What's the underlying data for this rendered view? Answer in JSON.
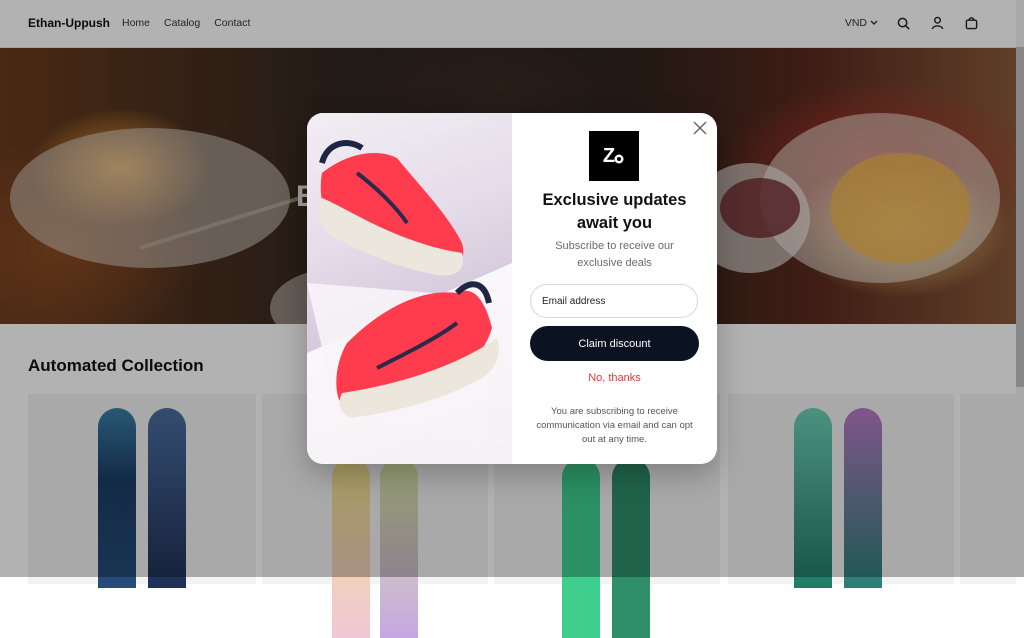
{
  "header": {
    "brand": "Ethan-Uppush",
    "nav": [
      "Home",
      "Catalog",
      "Contact"
    ],
    "currency": "VND",
    "icons": [
      "search-icon",
      "account-icon",
      "cart-icon"
    ]
  },
  "hero": {
    "title": "B"
  },
  "collection": {
    "title": "Automated Collection"
  },
  "popup": {
    "logo_text": "Z",
    "title": "Exclusive updates await you",
    "subtitle": "Subscribe to receive our exclusive deals",
    "email_placeholder": "Email address",
    "claim_label": "Claim discount",
    "decline_label": "No, thanks",
    "disclaimer": "You are subscribing to receive communication via email and can opt out at any time.",
    "colors": {
      "button": "#0b1221",
      "decline": "#e3382f",
      "shoe": "#ff3b4e"
    }
  }
}
